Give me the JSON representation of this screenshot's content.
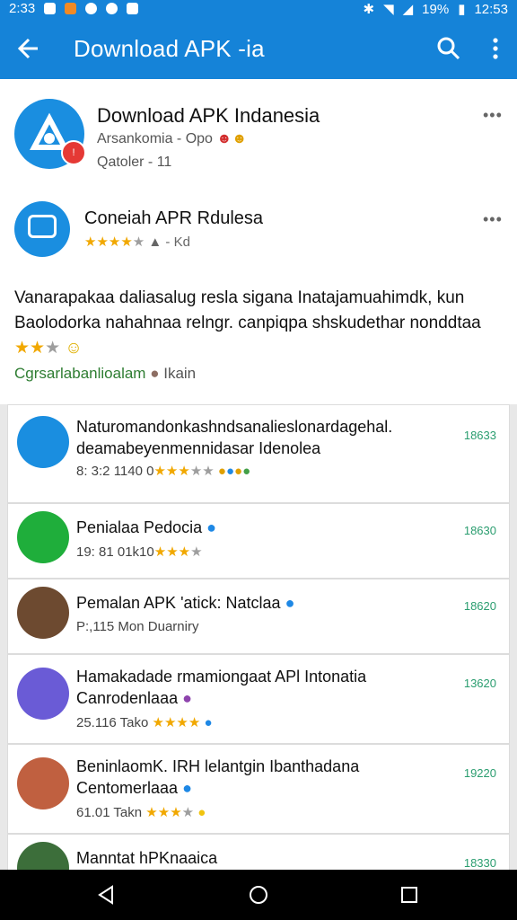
{
  "status": {
    "time_left": "2:33",
    "battery": "19%",
    "time_right": "12:53"
  },
  "appbar": {
    "title": "Download APK -ia"
  },
  "featured": {
    "title": "Download APK Indanesia",
    "subtitle": "Arsankomia - Opo",
    "meta": "Qatoler - 11"
  },
  "review_card": {
    "title": "Coneiah APR Rdulesa",
    "rating_text": "Kd",
    "description": "Vanarapakaa daliasalug resla sigana Inatajamuahimdk, kun Baolodorka nahahnaa relngr. canpiqpa shskudethar nonddtaa",
    "developer": "Cgrsarlabanlioalam",
    "developer_extra": "Ikain"
  },
  "list": [
    {
      "title": "Naturomandonkashndsanalieslonardagehal. deamabeyenmennidasar Idenolea",
      "meta": "8: 3:2 1140 0",
      "num": "18633",
      "icon_color": "#1a8ee0"
    },
    {
      "title": "Penialaa Pedocia",
      "meta": "19: 81 01k10",
      "num": "18630",
      "icon_color": "#1fae3b"
    },
    {
      "title": "Pemalan APK 'atick: Natclaa",
      "meta": "P:,115 Mon Duarniry",
      "num": "18620",
      "icon_color": "#6d4a30"
    },
    {
      "title": "Hamakadade rmamiongaat APl Intonatia Canrodenlaaa",
      "meta": "25.116 Tako",
      "num": "13620",
      "icon_color": "#6a5bd6"
    },
    {
      "title": "BeninlaomK. IRH lelantgin Ibanthadana Centomerlaaa",
      "meta": "61.01 Takn",
      "num": "19220",
      "icon_color": "#c06040"
    },
    {
      "title": "Manntat hPKnaaica",
      "meta": "",
      "num": "18330",
      "icon_color": "#3c6e3a"
    }
  ]
}
